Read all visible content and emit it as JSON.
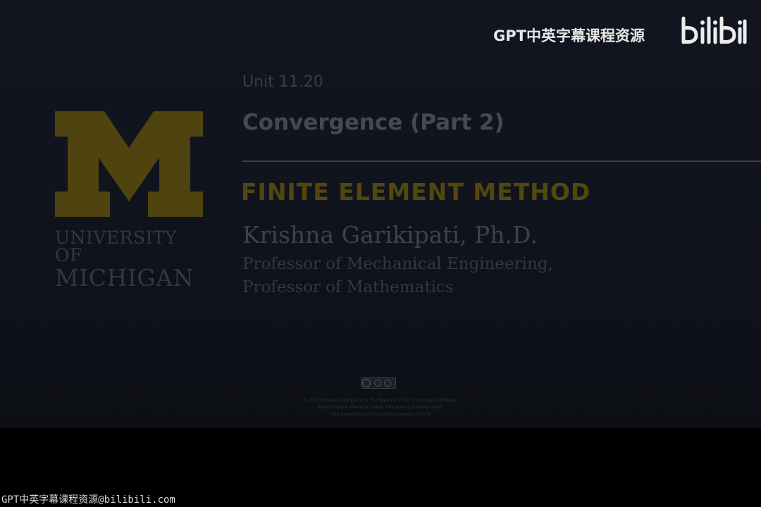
{
  "slide": {
    "unit": "Unit 11.20",
    "title": "Convergence (Part 2)",
    "course": "FINITE ELEMENT METHOD",
    "instructor": "Krishna Garikipati, Ph.D.",
    "affiliation_1": "Professor of Mechanical Engineering,",
    "affiliation_2": "Professor of Mathematics"
  },
  "logo": {
    "line1": "UNIVERSITY OF",
    "line2": "MICHIGAN",
    "icon": "block-m-logo"
  },
  "license": {
    "icon": "creative-commons-badge",
    "line1": "© 2015 Krishna Garikipati and The Regents of the University of Michigan",
    "line2": "Except where otherwise noted, this work is licensed under",
    "line3": "http://creativecommons.org/licenses/by-nc/3.0/"
  },
  "watermark": {
    "top_text": "GPT中英字幕课程资源",
    "logo_text": "bilibili",
    "bottom_text": "GPT中英字幕课程资源@bilibili.com"
  },
  "colors": {
    "background": "#121520",
    "maize": "#54460f",
    "text_dim": "#3f4248",
    "watermark": "#e6e6e6"
  }
}
